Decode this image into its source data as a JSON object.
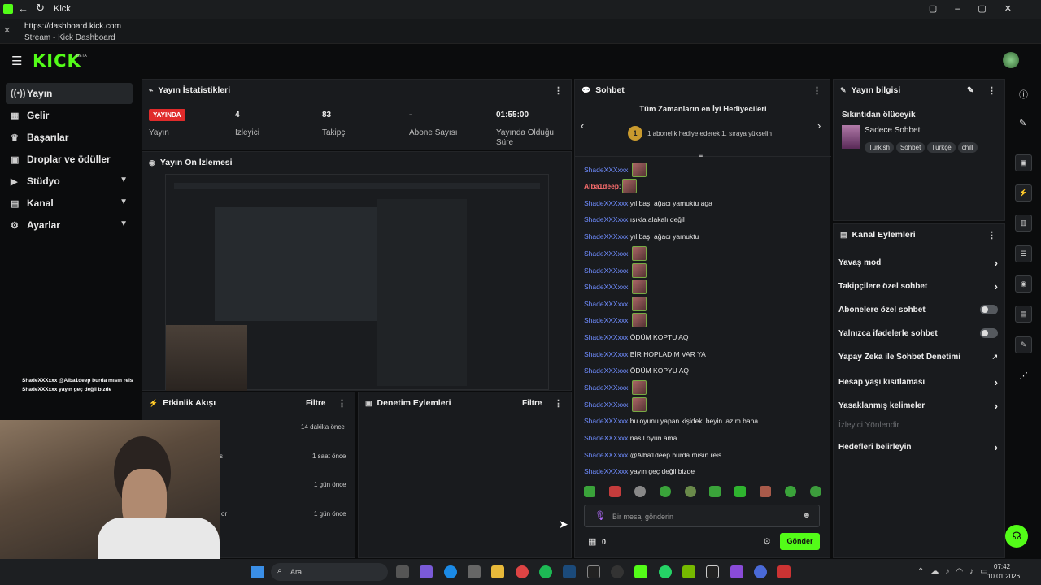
{
  "browser": {
    "title": "Kick",
    "url": "https://dashboard.kick.com",
    "subtitle": "Stream - Kick Dashboard"
  },
  "logo": "KICK",
  "logo_beta": "BETA",
  "sidebar": {
    "items": [
      {
        "label": "Yayın",
        "icon": "broadcast-icon"
      },
      {
        "label": "Gelir",
        "icon": "money-icon"
      },
      {
        "label": "Başarılar",
        "icon": "trophy-icon"
      },
      {
        "label": "Droplar ve ödüller",
        "icon": "gift-icon"
      },
      {
        "label": "Stüdyo",
        "icon": "studio-icon"
      },
      {
        "label": "Kanal",
        "icon": "channel-icon"
      },
      {
        "label": "Ayarlar",
        "icon": "settings-icon"
      }
    ]
  },
  "stats": {
    "title": "Yayın İstatistikleri",
    "live_badge": "YAYINDA",
    "live_label": "Yayın",
    "cols": [
      {
        "value": "4",
        "label": "İzleyici"
      },
      {
        "value": "83",
        "label": "Takipçi"
      },
      {
        "value": "-",
        "label": "Abone Sayısı"
      },
      {
        "value": "01:55:00",
        "label": "Yayında Olduğu Süre"
      }
    ]
  },
  "preview": {
    "title": "Yayın Ön İzlemesi"
  },
  "overlay_chat": [
    "ShadeXXXxxx @Alba1deep burda mısın reis",
    "ShadeXXXxxx yayın geç değil bizde"
  ],
  "activity": {
    "title": "Etkinlik Akışı",
    "filter": "Filtre",
    "times": [
      "14 dakika önce",
      "1 saat önce",
      "1 gün önce",
      "1 gün önce"
    ],
    "fragments": [
      "s",
      "or"
    ]
  },
  "moderation": {
    "title": "Denetim Eylemleri",
    "filter": "Filtre"
  },
  "chat": {
    "title": "Sohbet",
    "gifters_title": "Tüm Zamanların en İyi Hediyecileri",
    "gifter_rank": "1",
    "gifter_text": "1 abonelik hediye ederek 1. sıraya yükselin",
    "messages": [
      {
        "user": "ShadeXXXxxx",
        "text": "",
        "emote": true
      },
      {
        "user": "Alba1deep",
        "text": "",
        "emote": true,
        "mod": true
      },
      {
        "user": "ShadeXXXxxx",
        "text": "yıl başı ağacı yamuktu aga"
      },
      {
        "user": "ShadeXXXxxx",
        "text": "ışıkla alakalı değil"
      },
      {
        "user": "ShadeXXXxxx",
        "text": "yıl başı ağacı yamuktu"
      },
      {
        "user": "ShadeXXXxxx",
        "text": "",
        "emote": true
      },
      {
        "user": "ShadeXXXxxx",
        "text": "",
        "emote": true
      },
      {
        "user": "ShadeXXXxxx",
        "text": "",
        "emote": true
      },
      {
        "user": "ShadeXXXxxx",
        "text": "",
        "emote": true
      },
      {
        "user": "ShadeXXXxxx",
        "text": "",
        "emote": true
      },
      {
        "user": "ShadeXXXxxx",
        "text": "ÖDÜM KOPTU AQ"
      },
      {
        "user": "ShadeXXXxxx",
        "text": "BİR HOPLADIM VAR YA"
      },
      {
        "user": "ShadeXXXxxx",
        "text": "ÖDÜM KOPYU AQ"
      },
      {
        "user": "ShadeXXXxxx",
        "text": "",
        "emote": true
      },
      {
        "user": "ShadeXXXxxx",
        "text": "",
        "emote": true
      },
      {
        "user": "ShadeXXXxxx",
        "text": "bu oyunu yapan kişideki beyin lazım bana"
      },
      {
        "user": "ShadeXXXxxx",
        "text": "nasıl oyun ama"
      },
      {
        "user": "ShadeXXXxxx",
        "text": "@Alba1deep burda mısın reis"
      },
      {
        "user": "ShadeXXXxxx",
        "text": "yayın geç değil bizde"
      }
    ],
    "input_placeholder": "Bir mesaj gönderin",
    "count": "0",
    "send": "Gönder"
  },
  "stream_info": {
    "title": "Yayın bilgisi",
    "stream_title": "Sıkıntıdan ölüceyik",
    "category": "Sadece Sohbet",
    "tags": [
      "Turkish",
      "Sohbet",
      "Türkçe",
      "chill"
    ]
  },
  "channel_actions": {
    "title": "Kanal Eylemleri",
    "items": [
      {
        "label": "Yavaş mod",
        "type": "chevron"
      },
      {
        "label": "Takipçilere özel sohbet",
        "type": "chevron"
      },
      {
        "label": "Abonelere özel sohbet",
        "type": "toggle"
      },
      {
        "label": "Yalnızca ifadelerle sohbet",
        "type": "toggle"
      },
      {
        "label": "Yapay Zeka ile Sohbet Denetimi",
        "type": "external"
      },
      {
        "label": "Hesap yaşı kısıtlaması",
        "type": "chevron"
      },
      {
        "label": "Yasaklanmış kelimeler",
        "type": "chevron"
      },
      {
        "label": "İzleyici Yönlendir",
        "type": "disabled"
      },
      {
        "label": "Hedefleri belirleyin",
        "type": "chevron"
      }
    ]
  },
  "taskbar": {
    "search": "Ara",
    "time": "07:42",
    "date": "10.01.2026"
  },
  "colors": {
    "brand": "#53fc18",
    "live": "#e02b2b",
    "send": "#53fc18"
  }
}
